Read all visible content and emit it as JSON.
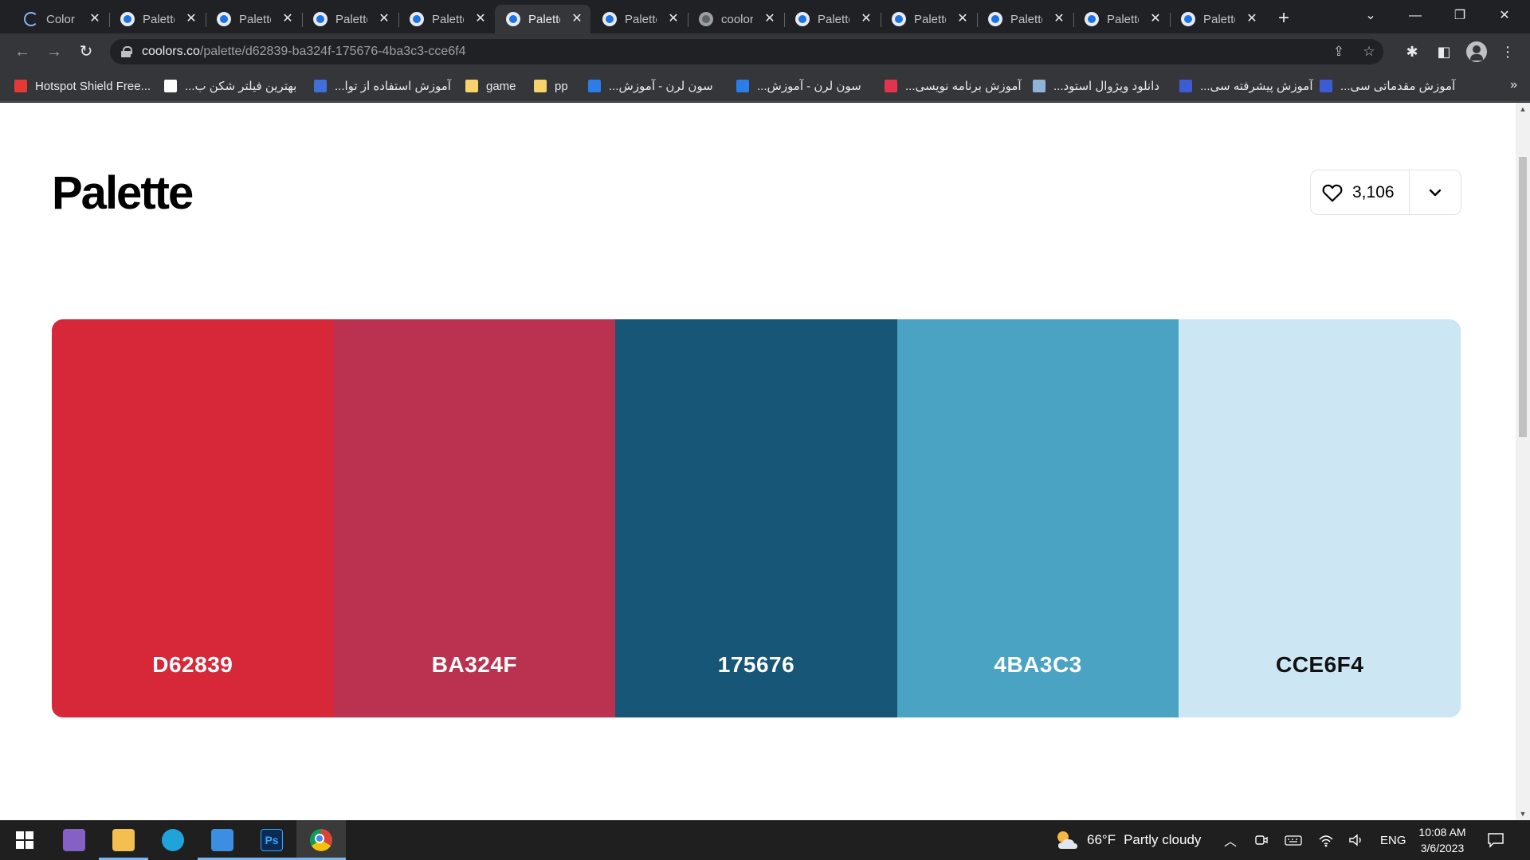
{
  "browser": {
    "tabs": [
      {
        "title": "Color",
        "favicon": "loading-spinner-icon",
        "active": false
      },
      {
        "title": "Palette",
        "favicon": "coolors-icon",
        "active": false
      },
      {
        "title": "Palette",
        "favicon": "coolors-icon",
        "active": false
      },
      {
        "title": "Palette",
        "favicon": "coolors-icon",
        "active": false
      },
      {
        "title": "Palette",
        "favicon": "coolors-icon",
        "active": false
      },
      {
        "title": "Palette",
        "favicon": "coolors-icon",
        "active": true
      },
      {
        "title": "Palette",
        "favicon": "coolors-icon",
        "active": false
      },
      {
        "title": "coolors",
        "favicon": "globe-icon",
        "active": false
      },
      {
        "title": "Palette",
        "favicon": "coolors-icon",
        "active": false
      },
      {
        "title": "Palette",
        "favicon": "coolors-icon",
        "active": false
      },
      {
        "title": "Palette",
        "favicon": "coolors-icon",
        "active": false
      },
      {
        "title": "Palette",
        "favicon": "coolors-icon",
        "active": false
      },
      {
        "title": "Palette",
        "favicon": "coolors-icon",
        "active": false
      }
    ],
    "close_glyph": "✕",
    "new_tab_glyph": "+",
    "window_controls": {
      "tab_search": "⌄",
      "minimize": "—",
      "restore": "❐",
      "close": "✕"
    },
    "url": {
      "host": "coolors.co",
      "path": "/palette/d62839-ba324f-175676-4ba3c3-cce6f4"
    },
    "nav": {
      "back": "←",
      "forward": "→",
      "reload": "↻"
    },
    "toolbar_icons": {
      "share": "⇪",
      "bookmark_star": "☆",
      "extensions": "✱",
      "side_panel": "◧",
      "menu": "⋮"
    },
    "bookmarks": [
      {
        "label": "Hotspot Shield Free...",
        "icon": "hotspot-shield-icon",
        "color": "#e53935",
        "rtl": false
      },
      {
        "label": "بهترین فیلتر شکن ب...",
        "icon": "google-icon",
        "color": "#ffffff",
        "rtl": true
      },
      {
        "label": "آموزش استفاده از توا...",
        "icon": "site-icon",
        "color": "#3f6fd8",
        "rtl": true
      },
      {
        "label": "game",
        "icon": "folder-icon",
        "color": "#f6d36b",
        "rtl": false
      },
      {
        "label": "pp",
        "icon": "folder-icon",
        "color": "#f6d36b",
        "rtl": false
      },
      {
        "label": "سون لرن - آموزش...",
        "icon": "sevenlearn-icon",
        "color": "#2b7de9",
        "rtl": true
      },
      {
        "label": "سون لرن - آموزش...",
        "icon": "sevenlearn-icon",
        "color": "#2b7de9",
        "rtl": true
      },
      {
        "label": "آموزش برنامه نویسی...",
        "icon": "site-icon",
        "color": "#e2334f",
        "rtl": true
      },
      {
        "label": "دانلود ویژوال استود...",
        "icon": "site-icon",
        "color": "#8fb3d9",
        "rtl": true
      },
      {
        "label": "آموزش پیشرفته سی...",
        "icon": "site-icon",
        "color": "#3e5bd6",
        "rtl": true
      },
      {
        "label": "آموزش مقدماتی سی...",
        "icon": "site-icon",
        "color": "#3e5bd6",
        "rtl": true
      }
    ],
    "bookmarks_overflow": "»"
  },
  "page": {
    "title": "Palette",
    "likes": "3,106",
    "swatches": [
      {
        "hex": "D62839",
        "color": "#D62839",
        "text_color": "#ffffff"
      },
      {
        "hex": "BA324F",
        "color": "#BA324F",
        "text_color": "#ffffff"
      },
      {
        "hex": "175676",
        "color": "#175676",
        "text_color": "#ffffff"
      },
      {
        "hex": "4BA3C3",
        "color": "#4BA3C3",
        "text_color": "#ffffff"
      },
      {
        "hex": "CCE6F4",
        "color": "#CCE6F4",
        "text_color": "#111111"
      }
    ]
  },
  "taskbar": {
    "apps": [
      {
        "name": "visual-studio-icon",
        "open": false,
        "active": false
      },
      {
        "name": "file-explorer-icon",
        "open": true,
        "active": false
      },
      {
        "name": "edge-icon",
        "open": false,
        "active": false
      },
      {
        "name": "photos-icon",
        "open": true,
        "active": false
      },
      {
        "name": "photoshop-icon",
        "open": true,
        "active": false
      },
      {
        "name": "chrome-icon",
        "open": true,
        "active": true
      }
    ],
    "weather": {
      "temp": "66°F",
      "condition": "Partly cloudy"
    },
    "language": "ENG",
    "time": "10:08 AM",
    "date": "3/6/2023"
  }
}
